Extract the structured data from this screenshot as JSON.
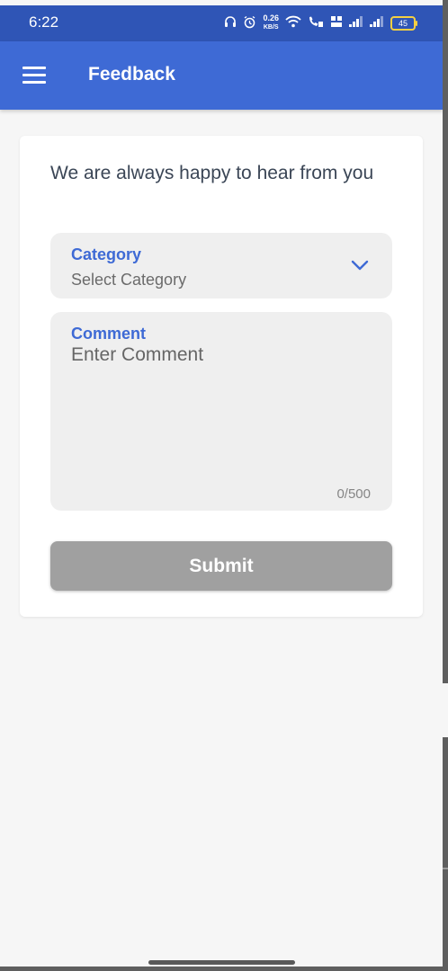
{
  "status_bar": {
    "time": "6:22",
    "net_speed_value": "0.26",
    "net_speed_unit": "KB/S",
    "battery": "45"
  },
  "app_bar": {
    "title": "Feedback"
  },
  "form": {
    "heading": "We are always happy to hear from you",
    "category": {
      "label": "Category",
      "value": "Select Category"
    },
    "comment": {
      "label": "Comment",
      "placeholder": "Enter Comment",
      "counter": "0/500"
    },
    "submit_label": "Submit"
  },
  "colors": {
    "status_bar": "#2f55b6",
    "app_bar": "#3e6ad5",
    "accent": "#3e6ad5",
    "submit_disabled": "#a0a0a0",
    "background": "#f6f6f6"
  }
}
